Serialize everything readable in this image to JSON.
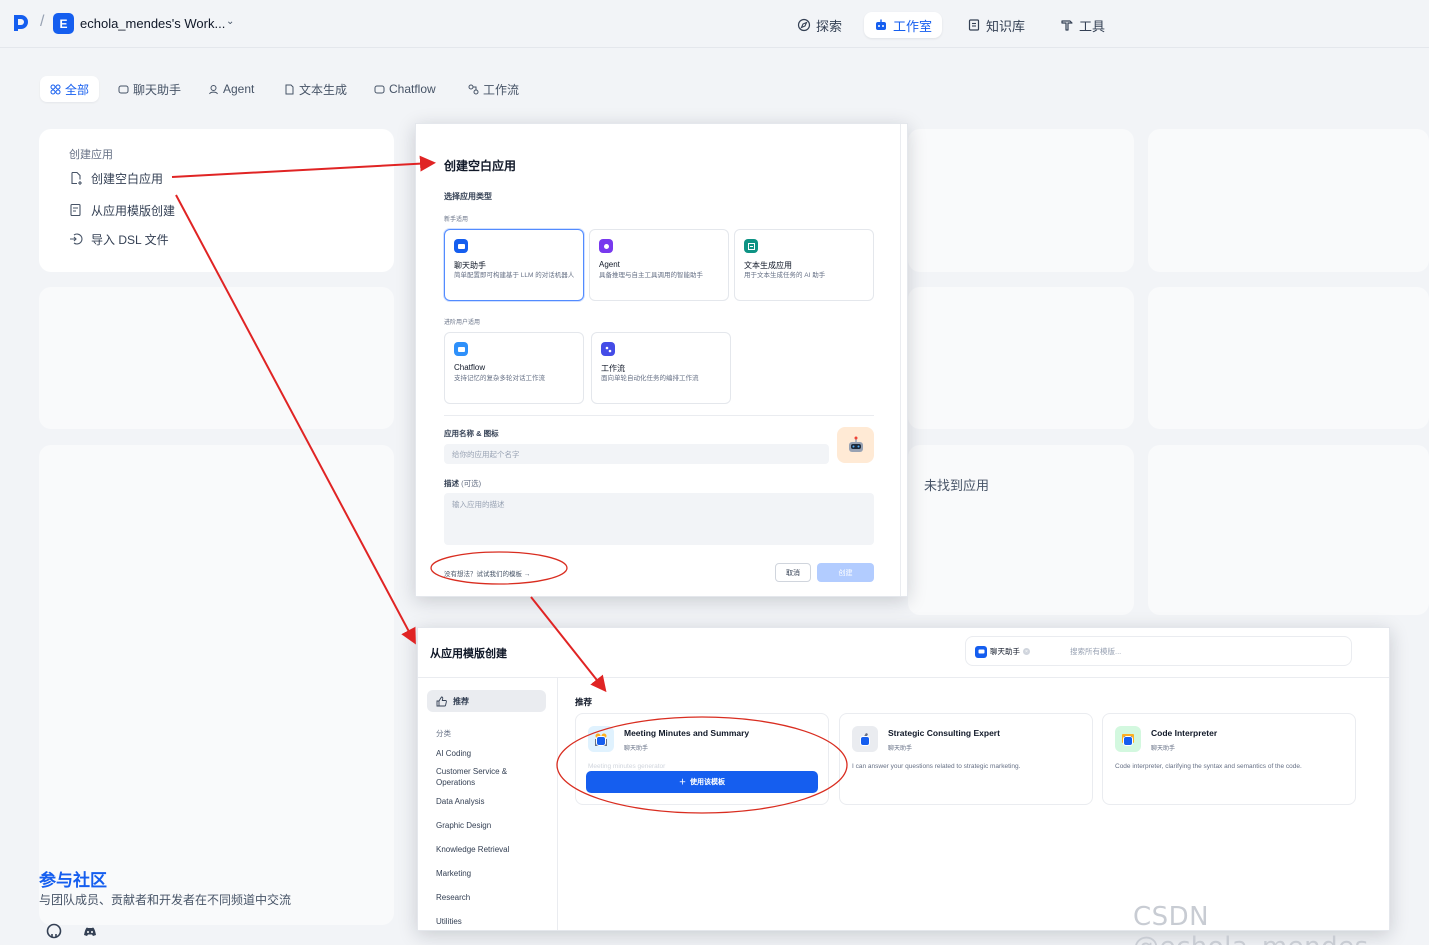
{
  "workspace": {
    "initial": "E",
    "name": "echola_mendes's Work..."
  },
  "nav": {
    "explore": "探索",
    "studio": "工作室",
    "knowledge": "知识库",
    "tools": "工具"
  },
  "tabs": [
    "全部",
    "聊天助手",
    "Agent",
    "文本生成",
    "Chatflow",
    "工作流"
  ],
  "create_card": {
    "title": "创建应用",
    "items": [
      "创建空白应用",
      "从应用模版创建",
      "导入 DSL 文件"
    ]
  },
  "empty_text": "未找到应用",
  "community": {
    "title": "参与社区",
    "subtitle": "与团队成员、贡献者和开发者在不同频道中交流"
  },
  "dialog_blank": {
    "title": "创建空白应用",
    "type_label": "选择应用类型",
    "beginner_label": "新手适用",
    "advanced_label": "进阶用户适用",
    "types": [
      {
        "name": "聊天助手",
        "desc": "简单配置即可构建基于 LLM 的对话机器人"
      },
      {
        "name": "Agent",
        "desc": "具备推理与自主工具调用的智能助手"
      },
      {
        "name": "文本生成应用",
        "desc": "用于文本生成任务的 AI 助手"
      },
      {
        "name": "Chatflow",
        "desc": "支持记忆的复杂多轮对话工作流"
      },
      {
        "name": "工作流",
        "desc": "面向单轮自动化任务的编排工作流"
      }
    ],
    "name_label": "应用名称 & 图标",
    "name_placeholder": "给你的应用起个名字",
    "desc_label": "描述",
    "desc_optional": "(可选)",
    "desc_placeholder": "输入应用的描述",
    "template_link": "没有想法？试试我们的模板 →",
    "cancel": "取消",
    "create": "创建"
  },
  "dialog_template": {
    "title": "从应用模版创建",
    "filter_chip": "聊天助手",
    "search_placeholder": "搜索所有模版...",
    "recommend": "推荐",
    "category_label": "分类",
    "categories": [
      "AI Coding",
      "Customer Service & Operations",
      "Data Analysis",
      "Graphic Design",
      "Knowledge Retrieval",
      "Marketing",
      "Research",
      "Utilities"
    ],
    "section_title": "推荐",
    "use_button": "使用该模板",
    "templates": [
      {
        "name": "Meeting Minutes and Summary",
        "type": "聊天助手",
        "desc": "Meeting minutes generator"
      },
      {
        "name": "Strategic Consulting Expert",
        "type": "聊天助手",
        "desc": "I can answer your questions related to strategic marketing."
      },
      {
        "name": "Code Interpreter",
        "type": "聊天助手",
        "desc": "Code interpreter, clarifying the syntax and semantics of the code."
      }
    ]
  },
  "watermark": "CSDN @echola_mendes",
  "colors": {
    "primary": "#155eef",
    "arrow": "#e02424",
    "annotation": "#d92d20"
  }
}
